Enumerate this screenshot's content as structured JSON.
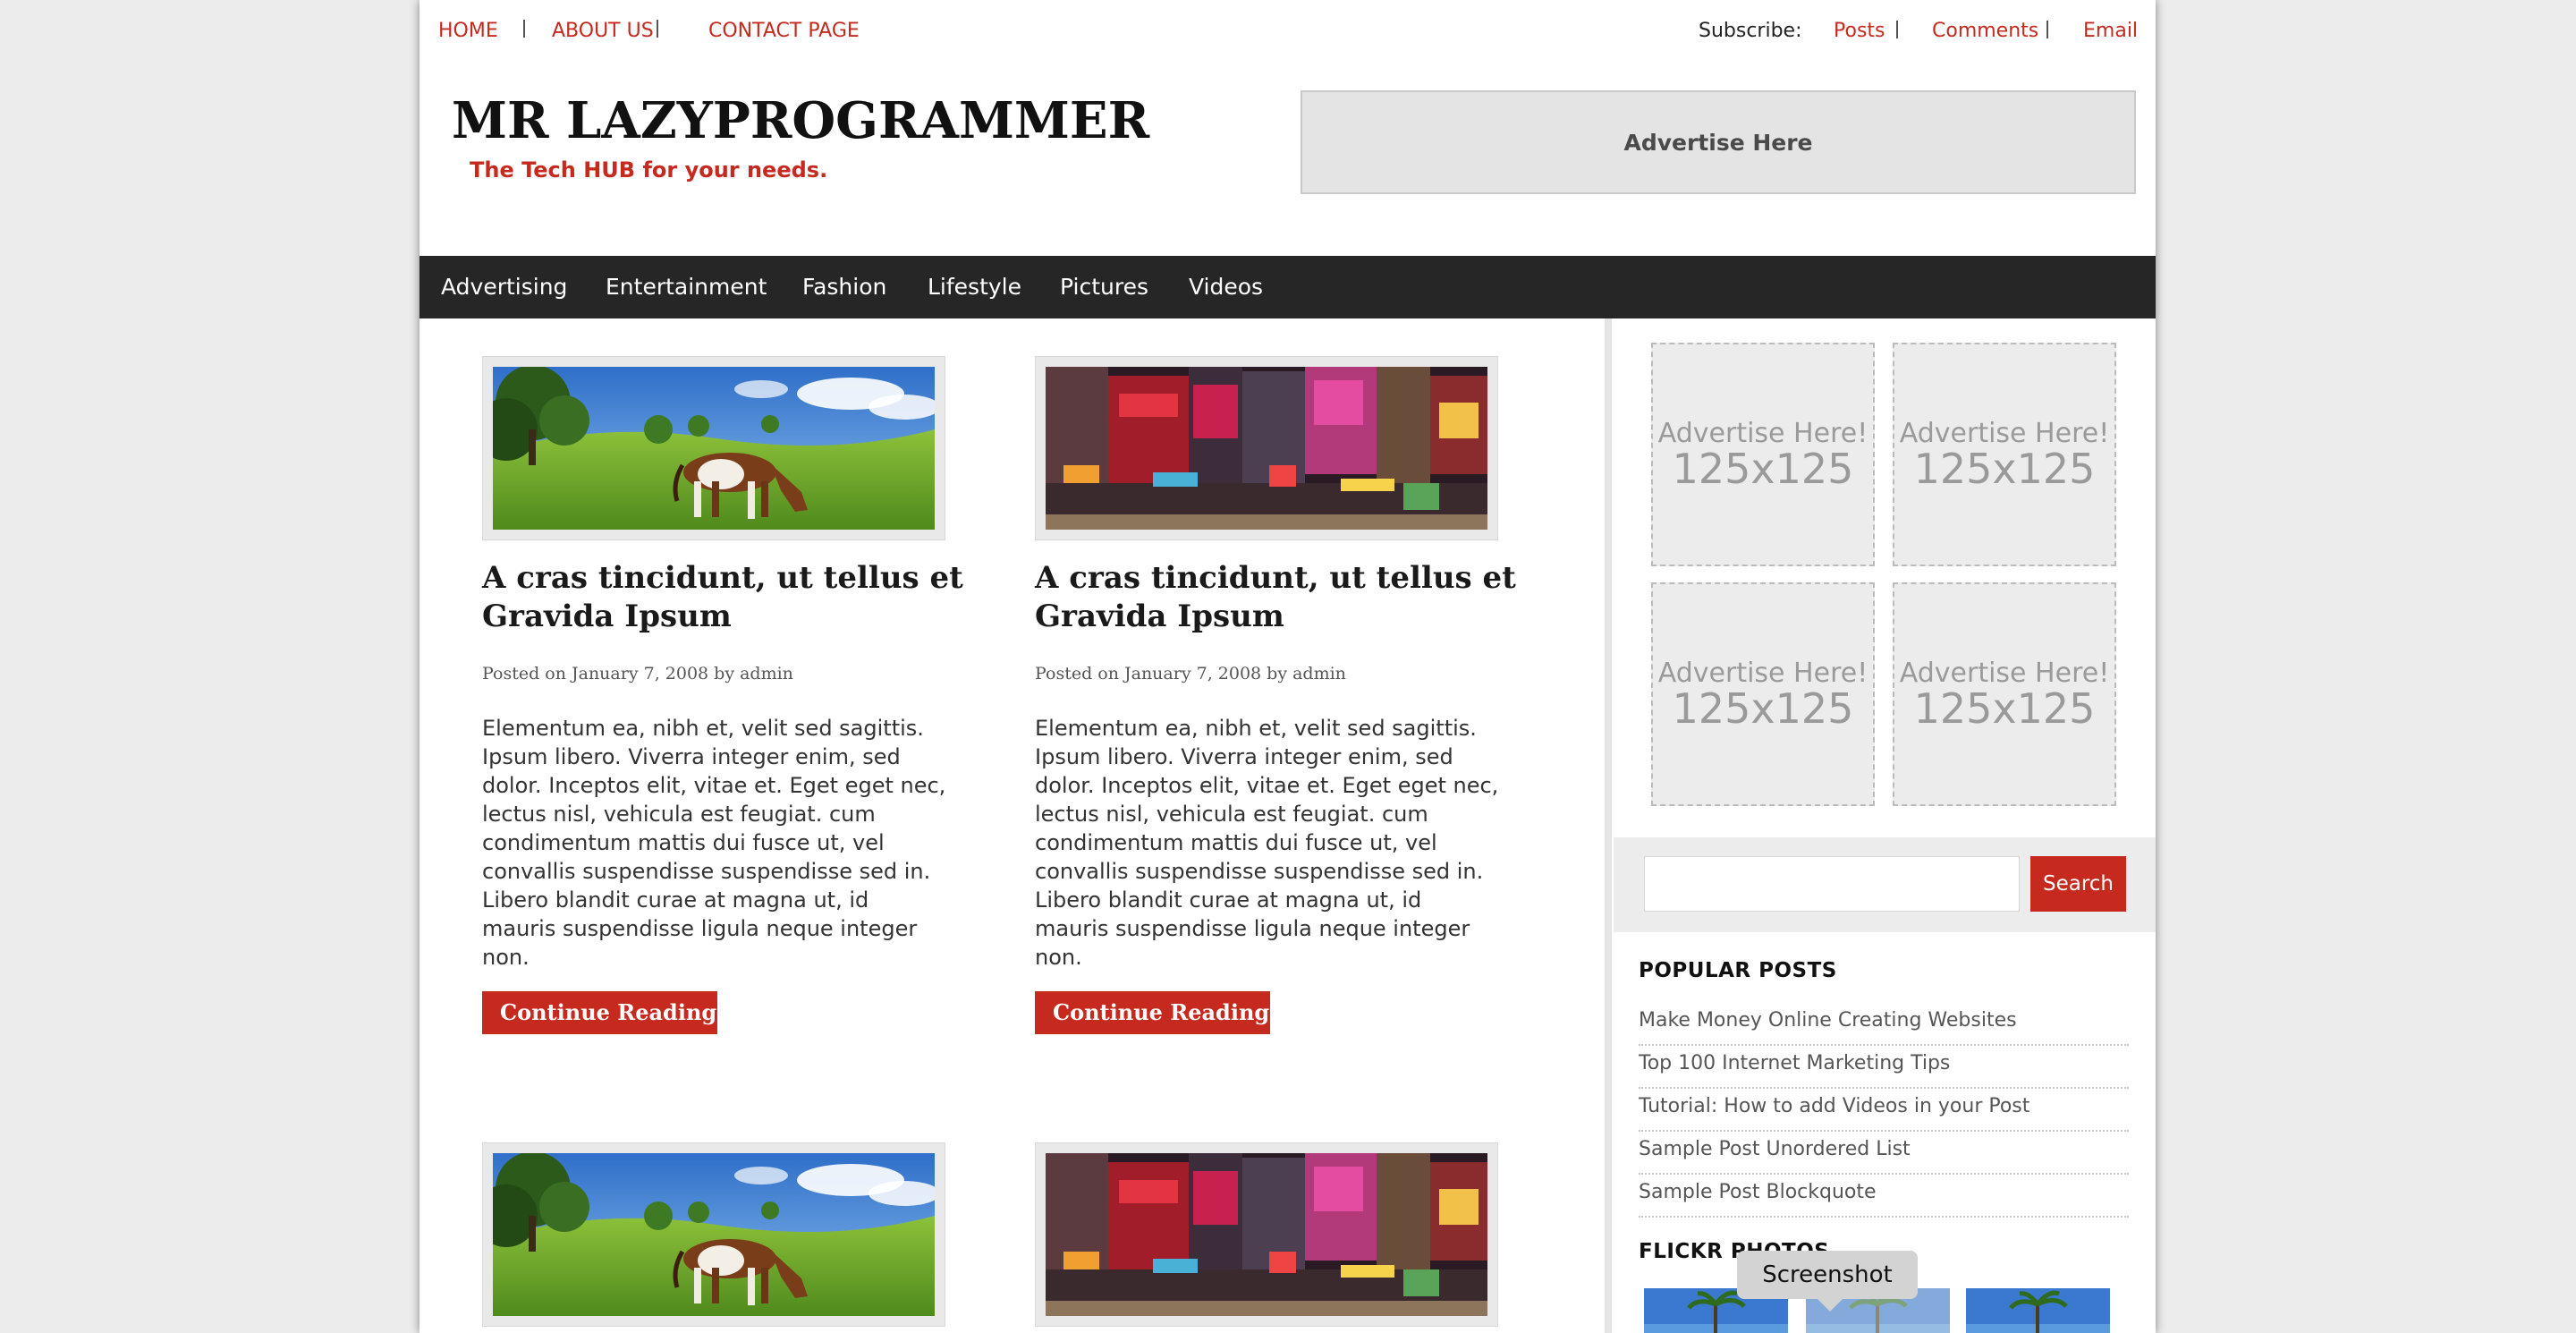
{
  "top_nav": {
    "links": [
      "HOME",
      "ABOUT US",
      "CONTACT PAGE"
    ],
    "subscribe_label": "Subscribe:",
    "subscribe_links": [
      "Posts",
      "Comments",
      "Email"
    ]
  },
  "header": {
    "site_title": "MR LAZYPROGRAMMER",
    "tagline": "The Tech HUB for your needs.",
    "ad_banner": "Advertise Here"
  },
  "main_nav": {
    "items": [
      "Advertising",
      "Entertainment",
      "Fashion",
      "Lifestyle",
      "Pictures",
      "Videos"
    ]
  },
  "posts": [
    {
      "image": "horse-meadow",
      "title": "A cras tincidunt, ut tellus et Gravida Ipsum",
      "meta": "Posted on January 7, 2008 by admin",
      "excerpt": "Elementum ea, nibh et, velit sed sagittis. Ipsum libero. Viverra integer enim, sed dolor. Inceptos elit, vitae et. Eget eget nec, lectus nisl, vehicula est feugiat. cum condimentum mattis dui fusce ut, vel convallis suspendisse suspendisse sed in. Libero blandit curae at magna ut, id mauris suspendisse ligula neque integer non.",
      "button": "Continue Reading"
    },
    {
      "image": "city-billboards",
      "title": "A cras tincidunt, ut tellus et Gravida Ipsum",
      "meta": "Posted on January 7, 2008 by admin",
      "excerpt": "Elementum ea, nibh et, velit sed sagittis. Ipsum libero. Viverra integer enim, sed dolor. Inceptos elit, vitae et. Eget eget nec, lectus nisl, vehicula est feugiat. cum condimentum mattis dui fusce ut, vel convallis suspendisse suspendisse sed in. Libero blandit curae at magna ut, id mauris suspendisse ligula neque integer non.",
      "button": "Continue Reading"
    },
    {
      "image": "horse-meadow"
    },
    {
      "image": "city-billboards"
    }
  ],
  "sidebar": {
    "ads": [
      {
        "line1": "Advertise Here!",
        "line2": "125x125"
      },
      {
        "line1": "Advertise Here!",
        "line2": "125x125"
      },
      {
        "line1": "Advertise Here!",
        "line2": "125x125"
      },
      {
        "line1": "Advertise Here!",
        "line2": "125x125"
      }
    ],
    "search": {
      "placeholder": "",
      "button": "Search"
    },
    "popular_posts": {
      "title": "POPULAR POSTS",
      "items": [
        "Make Money Online Creating Websites",
        "Top 100 Internet Marketing Tips",
        "Tutorial: How to add Videos in your Post",
        "Sample Post Unordered List",
        "Sample Post Blockquote"
      ]
    },
    "flickr": {
      "title": "FLICKR PHOTOS"
    }
  },
  "tooltip": {
    "text": "Screenshot"
  },
  "colors": {
    "accent": "#c62a1e",
    "nav_bg": "#262626"
  }
}
